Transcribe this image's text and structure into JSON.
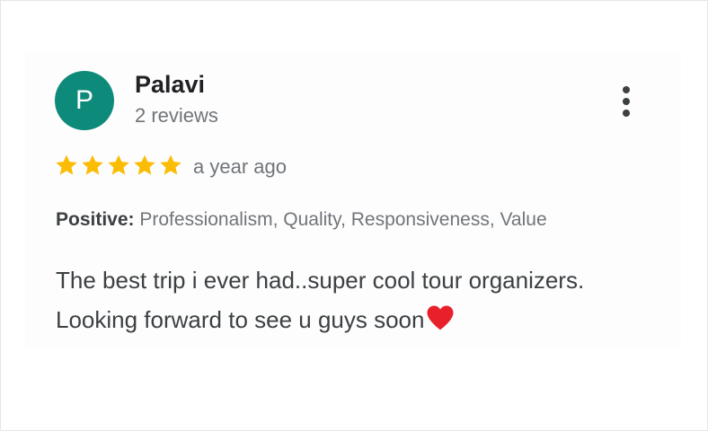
{
  "review": {
    "avatar_letter": "P",
    "author_name": "Palavi",
    "review_count": "2 reviews",
    "rating": 5,
    "rating_max": 5,
    "time_ago": "a year ago",
    "attributes_label": "Positive:",
    "attributes_value": "Professionalism, Quality, Responsiveness, Value",
    "text_line1": "The best trip i ever had..super cool tour organizers.",
    "text_line2": "Looking forward to see u guys soon"
  },
  "icons": {
    "menu": "more-vert-icon",
    "star": "star-icon",
    "heart": "heart-icon"
  },
  "colors": {
    "avatar_bg": "#0e8a7a",
    "star": "#fbbc04",
    "heart": "#e8202c",
    "primary_text": "#202124",
    "secondary_text": "#70757a"
  }
}
